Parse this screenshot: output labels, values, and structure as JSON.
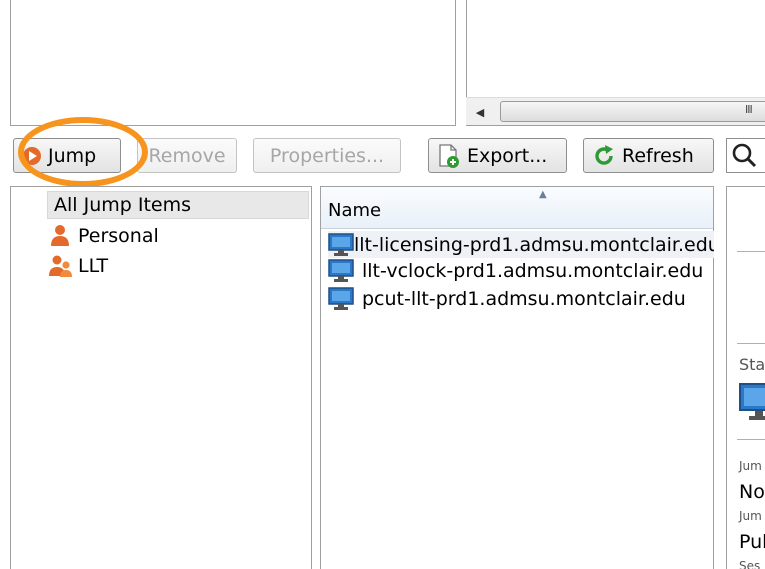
{
  "toolbar": {
    "jump_label": "Jump",
    "remove_label": "Remove",
    "properties_label": "Properties...",
    "export_label": "Export...",
    "refresh_label": "Refresh"
  },
  "scrollbar": {
    "grip": "III"
  },
  "tree": {
    "items": [
      {
        "label": "All Jump Items",
        "icon": "none"
      },
      {
        "label": "Personal",
        "icon": "person-icon"
      },
      {
        "label": "LLT",
        "icon": "group-icon"
      }
    ]
  },
  "list": {
    "column_header": "Name",
    "rows": [
      {
        "name": "llt-licensing-prd1.admsu.montclair.edu",
        "icon": "computer-icon"
      },
      {
        "name": "llt-vclock-prd1.admsu.montclair.edu",
        "icon": "computer-icon"
      },
      {
        "name": "pcut-llt-prd1.admsu.montclair.edu",
        "icon": "computer-icon"
      }
    ]
  },
  "details": {
    "status_label": "Sta",
    "jump_label_1": "Jum",
    "value_1": "Not",
    "jump_label_2": "Jum",
    "value_2": "Pub",
    "session_label": "Ses"
  },
  "colors": {
    "highlight": "#f7941d",
    "accent_orange": "#e46a2b",
    "refresh_green": "#2f9a33",
    "monitor_blue": "#2a78c8"
  }
}
